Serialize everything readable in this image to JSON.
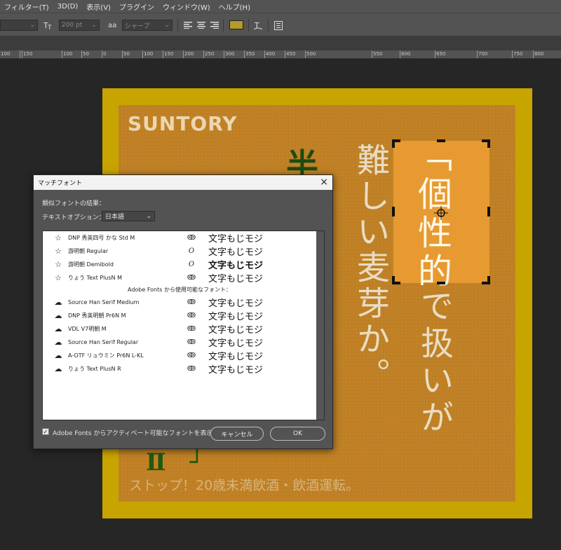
{
  "menubar": {
    "items": [
      "フィルター(T)",
      "3D(D)",
      "表示(V)",
      "プラグイン",
      "ウィンドウ(W)",
      "ヘルプ(H)"
    ]
  },
  "options_bar": {
    "font_size_placeholder": "200 pt",
    "aa_label": "aa",
    "antialias": "シャープ",
    "text_color": "#b49a2a"
  },
  "ruler": {
    "labels": [
      "100",
      "150",
      "100",
      "50",
      "0",
      "50",
      "100",
      "150",
      "200",
      "250",
      "300",
      "350",
      "400",
      "450",
      "500",
      "550",
      "600",
      "650",
      "700",
      "750",
      "800"
    ]
  },
  "poster": {
    "brand": "SUNTORY",
    "col_right_1": "難しい麦芽か。",
    "col_selected": "「個性的",
    "col_selected_cont": "で扱いが",
    "green_top": "半",
    "green_bottom": "Ⅱ　┘",
    "footer": "ストップ！20歳未満飲酒・飲酒運転。",
    "colors": {
      "artboard_border": "#c8a400",
      "poster_bg": "#c07f22",
      "selection_bg": "#e79a31"
    }
  },
  "dialog": {
    "title": "マッチフォント",
    "close": "×",
    "results_label": "類似フォントの結果：",
    "text_option_label": "テキストオプション：",
    "language": "日本語",
    "section_header": "Adobe Fonts から使用可能なフォント：",
    "installed_fonts": [
      {
        "name": "DNP 秀英四号 かな Std M",
        "type_icon": "cc-icon",
        "sample": "文字もじモジ"
      },
      {
        "name": "游明朝 Regular",
        "type_icon": "opentype-icon",
        "sample": "文字もじモジ"
      },
      {
        "name": "游明朝 Demibold",
        "type_icon": "opentype-icon",
        "sample": "文字もじモジ"
      },
      {
        "name": "りょう Text PlusN M",
        "type_icon": "cc-icon",
        "sample": "文字もじモジ"
      }
    ],
    "adobe_fonts": [
      {
        "name": "Source Han Serif Medium",
        "type_icon": "cc-icon",
        "sample": "文字もじモジ"
      },
      {
        "name": "DNP 秀英明朝 Pr6N M",
        "type_icon": "cc-icon",
        "sample": "文字もじモジ"
      },
      {
        "name": "VDL V7明朝 M",
        "type_icon": "cc-icon",
        "sample": "文字もじモジ"
      },
      {
        "name": "Source Han Serif Regular",
        "type_icon": "cc-icon",
        "sample": "文字もじモジ"
      },
      {
        "name": "A-OTF リュウミン Pr6N L-KL",
        "type_icon": "cc-icon",
        "sample": "文字もじモジ"
      },
      {
        "name": "りょう Text PlusN R",
        "type_icon": "cc-icon",
        "sample": "文字もじモジ"
      }
    ],
    "checkbox_label": "Adobe Fonts からアクティベート可能なフォントを表示",
    "checkbox_checked": true,
    "cancel_label": "キャンセル",
    "ok_label": "OK"
  }
}
